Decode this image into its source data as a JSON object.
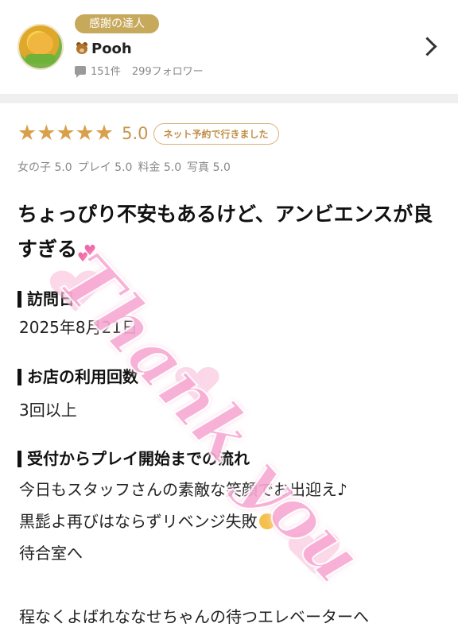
{
  "profile": {
    "badge": "感謝の達人",
    "username": "Pooh",
    "review_count": "151件",
    "followers": "299フォロワー"
  },
  "rating": {
    "stars": 5,
    "score": "5.0",
    "method": "ネット予約で行きました",
    "subscores": [
      "女の子 5.0",
      "プレイ 5.0",
      "料金 5.0",
      "写真 5.0"
    ]
  },
  "review": {
    "title": "ちょっぴり不安もあるけど、アンビエンスが良すぎる",
    "visit_date_heading": "訪問日",
    "visit_date": "2025年8月21日",
    "usage_count_heading": "お店の利用回数",
    "usage_count": "3回以上",
    "flow_heading": "受付からプレイ開始までの流れ",
    "flow_lines": [
      "今日もスタッフさんの素敵な笑顔でお出迎え♪",
      "黒髭よ再びはならずリベンジ失敗",
      "待合室へ",
      "",
      "程なくよばれななせちゃんの待つエレベーターへ"
    ]
  },
  "watermark_text": "Thank you",
  "colors": {
    "badge_gold": "#c7a95c",
    "star": "#d8a04a",
    "pill_border": "#d8b07a",
    "watermark_pink": "#f7a9d2"
  }
}
